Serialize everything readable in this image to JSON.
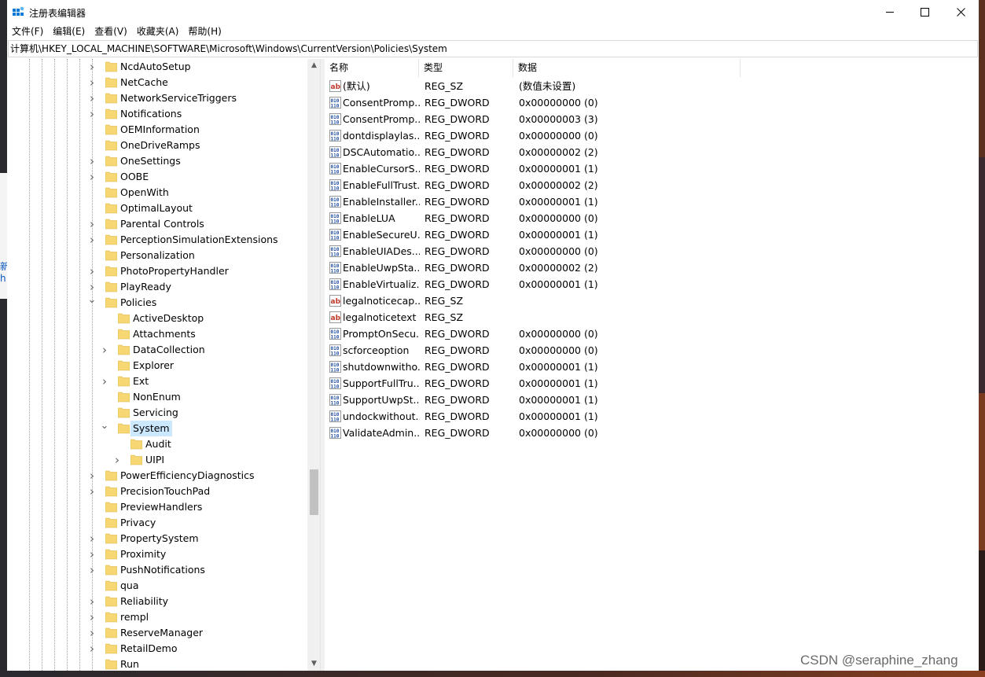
{
  "window": {
    "title": "注册表编辑器",
    "icon": "regedit-icon"
  },
  "menu": [
    "文件(F)",
    "编辑(E)",
    "查看(V)",
    "收藏夹(A)",
    "帮助(H)"
  ],
  "address": "计算机\\HKEY_LOCAL_MACHINE\\SOFTWARE\\Microsoft\\Windows\\CurrentVersion\\Policies\\System",
  "desktop_fragments": [
    "新",
    "h",
    "c"
  ],
  "tree": [
    {
      "label": "NcdAutoSetup",
      "depth": 0,
      "expander": "collapsed"
    },
    {
      "label": "NetCache",
      "depth": 0,
      "expander": "collapsed"
    },
    {
      "label": "NetworkServiceTriggers",
      "depth": 0,
      "expander": "collapsed"
    },
    {
      "label": "Notifications",
      "depth": 0,
      "expander": "collapsed"
    },
    {
      "label": "OEMInformation",
      "depth": 0,
      "expander": "none"
    },
    {
      "label": "OneDriveRamps",
      "depth": 0,
      "expander": "none"
    },
    {
      "label": "OneSettings",
      "depth": 0,
      "expander": "collapsed"
    },
    {
      "label": "OOBE",
      "depth": 0,
      "expander": "collapsed"
    },
    {
      "label": "OpenWith",
      "depth": 0,
      "expander": "none"
    },
    {
      "label": "OptimalLayout",
      "depth": 0,
      "expander": "none"
    },
    {
      "label": "Parental Controls",
      "depth": 0,
      "expander": "collapsed"
    },
    {
      "label": "PerceptionSimulationExtensions",
      "depth": 0,
      "expander": "collapsed"
    },
    {
      "label": "Personalization",
      "depth": 0,
      "expander": "none"
    },
    {
      "label": "PhotoPropertyHandler",
      "depth": 0,
      "expander": "collapsed"
    },
    {
      "label": "PlayReady",
      "depth": 0,
      "expander": "collapsed"
    },
    {
      "label": "Policies",
      "depth": 0,
      "expander": "expanded"
    },
    {
      "label": "ActiveDesktop",
      "depth": 1,
      "expander": "none"
    },
    {
      "label": "Attachments",
      "depth": 1,
      "expander": "none"
    },
    {
      "label": "DataCollection",
      "depth": 1,
      "expander": "collapsed"
    },
    {
      "label": "Explorer",
      "depth": 1,
      "expander": "none"
    },
    {
      "label": "Ext",
      "depth": 1,
      "expander": "collapsed"
    },
    {
      "label": "NonEnum",
      "depth": 1,
      "expander": "none"
    },
    {
      "label": "Servicing",
      "depth": 1,
      "expander": "none"
    },
    {
      "label": "System",
      "depth": 1,
      "expander": "expanded",
      "selected": true
    },
    {
      "label": "Audit",
      "depth": 2,
      "expander": "none"
    },
    {
      "label": "UIPI",
      "depth": 2,
      "expander": "collapsed"
    },
    {
      "label": "PowerEfficiencyDiagnostics",
      "depth": 0,
      "expander": "collapsed"
    },
    {
      "label": "PrecisionTouchPad",
      "depth": 0,
      "expander": "collapsed"
    },
    {
      "label": "PreviewHandlers",
      "depth": 0,
      "expander": "none"
    },
    {
      "label": "Privacy",
      "depth": 0,
      "expander": "none"
    },
    {
      "label": "PropertySystem",
      "depth": 0,
      "expander": "collapsed"
    },
    {
      "label": "Proximity",
      "depth": 0,
      "expander": "collapsed"
    },
    {
      "label": "PushNotifications",
      "depth": 0,
      "expander": "collapsed"
    },
    {
      "label": "qua",
      "depth": 0,
      "expander": "none"
    },
    {
      "label": "Reliability",
      "depth": 0,
      "expander": "collapsed"
    },
    {
      "label": "rempl",
      "depth": 0,
      "expander": "collapsed"
    },
    {
      "label": "ReserveManager",
      "depth": 0,
      "expander": "collapsed"
    },
    {
      "label": "RetailDemo",
      "depth": 0,
      "expander": "collapsed"
    },
    {
      "label": "Run",
      "depth": 0,
      "expander": "none"
    }
  ],
  "columns": {
    "name": "名称",
    "type": "类型",
    "data": "数据"
  },
  "values": [
    {
      "icon": "string-value-icon",
      "name": "(默认)",
      "type": "REG_SZ",
      "data": "(数值未设置)"
    },
    {
      "icon": "binary-value-icon",
      "name": "ConsentPromp...",
      "type": "REG_DWORD",
      "data": "0x00000000 (0)"
    },
    {
      "icon": "binary-value-icon",
      "name": "ConsentPromp...",
      "type": "REG_DWORD",
      "data": "0x00000003 (3)"
    },
    {
      "icon": "binary-value-icon",
      "name": "dontdisplaylas...",
      "type": "REG_DWORD",
      "data": "0x00000000 (0)"
    },
    {
      "icon": "binary-value-icon",
      "name": "DSCAutomatio...",
      "type": "REG_DWORD",
      "data": "0x00000002 (2)"
    },
    {
      "icon": "binary-value-icon",
      "name": "EnableCursorS...",
      "type": "REG_DWORD",
      "data": "0x00000001 (1)"
    },
    {
      "icon": "binary-value-icon",
      "name": "EnableFullTrust...",
      "type": "REG_DWORD",
      "data": "0x00000002 (2)"
    },
    {
      "icon": "binary-value-icon",
      "name": "EnableInstaller...",
      "type": "REG_DWORD",
      "data": "0x00000001 (1)"
    },
    {
      "icon": "binary-value-icon",
      "name": "EnableLUA",
      "type": "REG_DWORD",
      "data": "0x00000000 (0)"
    },
    {
      "icon": "binary-value-icon",
      "name": "EnableSecureU...",
      "type": "REG_DWORD",
      "data": "0x00000001 (1)"
    },
    {
      "icon": "binary-value-icon",
      "name": "EnableUIADes...",
      "type": "REG_DWORD",
      "data": "0x00000000 (0)"
    },
    {
      "icon": "binary-value-icon",
      "name": "EnableUwpSta...",
      "type": "REG_DWORD",
      "data": "0x00000002 (2)"
    },
    {
      "icon": "binary-value-icon",
      "name": "EnableVirtualiz...",
      "type": "REG_DWORD",
      "data": "0x00000001 (1)"
    },
    {
      "icon": "string-value-icon",
      "name": "legalnoticecap...",
      "type": "REG_SZ",
      "data": ""
    },
    {
      "icon": "string-value-icon",
      "name": "legalnoticetext",
      "type": "REG_SZ",
      "data": ""
    },
    {
      "icon": "binary-value-icon",
      "name": "PromptOnSecu...",
      "type": "REG_DWORD",
      "data": "0x00000000 (0)"
    },
    {
      "icon": "binary-value-icon",
      "name": "scforceoption",
      "type": "REG_DWORD",
      "data": "0x00000000 (0)"
    },
    {
      "icon": "binary-value-icon",
      "name": "shutdownwitho...",
      "type": "REG_DWORD",
      "data": "0x00000001 (1)"
    },
    {
      "icon": "binary-value-icon",
      "name": "SupportFullTru...",
      "type": "REG_DWORD",
      "data": "0x00000001 (1)"
    },
    {
      "icon": "binary-value-icon",
      "name": "SupportUwpSt...",
      "type": "REG_DWORD",
      "data": "0x00000001 (1)"
    },
    {
      "icon": "binary-value-icon",
      "name": "undockwithout...",
      "type": "REG_DWORD",
      "data": "0x00000001 (1)"
    },
    {
      "icon": "binary-value-icon",
      "name": "ValidateAdmin...",
      "type": "REG_DWORD",
      "data": "0x00000000 (0)"
    }
  ],
  "watermark": "CSDN @seraphine_zhang",
  "colors": {
    "selection": "#cce8ff",
    "folder": "#f7d774",
    "accent": "#0078d7"
  }
}
